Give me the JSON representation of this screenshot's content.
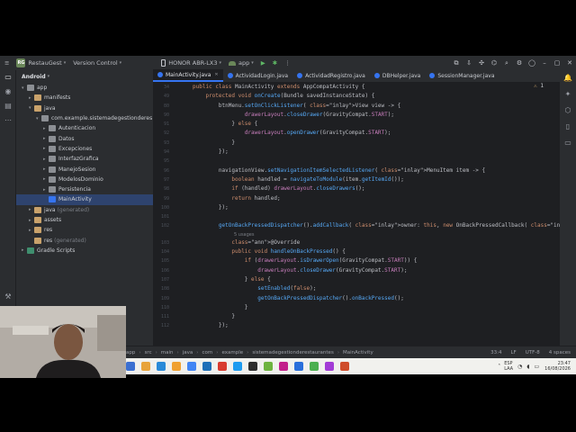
{
  "titlebar": {
    "project_badge": "RG",
    "project_name": "RestauGest",
    "vcs": "Version Control",
    "device": "HONOR ABR-LX3",
    "run_config": "app"
  },
  "project_panel": {
    "title": "Android",
    "tree": [
      {
        "label": "app",
        "indent": 0,
        "arrow": "▾",
        "icon": "fold-grey",
        "muted": ""
      },
      {
        "label": "manifests",
        "indent": 1,
        "arrow": "▸",
        "icon": "fold",
        "muted": ""
      },
      {
        "label": "java",
        "indent": 1,
        "arrow": "▾",
        "icon": "fold",
        "muted": ""
      },
      {
        "label": "com.example.sistemadegestionderes",
        "indent": 2,
        "arrow": "▾",
        "icon": "fold-grey",
        "muted": ""
      },
      {
        "label": "Autenticacion",
        "indent": 3,
        "arrow": "▸",
        "icon": "fold-grey",
        "muted": ""
      },
      {
        "label": "Datos",
        "indent": 3,
        "arrow": "▸",
        "icon": "fold-grey",
        "muted": ""
      },
      {
        "label": "Excepciones",
        "indent": 3,
        "arrow": "▸",
        "icon": "fold-grey",
        "muted": ""
      },
      {
        "label": "InterfazGrafica",
        "indent": 3,
        "arrow": "▸",
        "icon": "fold-grey",
        "muted": ""
      },
      {
        "label": "ManejoSesion",
        "indent": 3,
        "arrow": "▸",
        "icon": "fold-grey",
        "muted": ""
      },
      {
        "label": "ModelosDominio",
        "indent": 3,
        "arrow": "▸",
        "icon": "fold-grey",
        "muted": ""
      },
      {
        "label": "Persistencia",
        "indent": 3,
        "arrow": "▸",
        "icon": "fold-grey",
        "muted": ""
      },
      {
        "label": "MainActivity",
        "indent": 3,
        "arrow": "",
        "icon": "java-ico",
        "muted": "",
        "selected": true
      },
      {
        "label": "java",
        "indent": 1,
        "arrow": "▸",
        "icon": "fold",
        "muted": "(generated)"
      },
      {
        "label": "assets",
        "indent": 1,
        "arrow": "▸",
        "icon": "fold",
        "muted": ""
      },
      {
        "label": "res",
        "indent": 1,
        "arrow": "▸",
        "icon": "fold",
        "muted": ""
      },
      {
        "label": "res",
        "indent": 1,
        "arrow": "",
        "icon": "fold",
        "muted": "(generated)"
      },
      {
        "label": "Gradle Scripts",
        "indent": 0,
        "arrow": "▸",
        "icon": "gradle-ico",
        "muted": ""
      }
    ]
  },
  "tabs": [
    {
      "label": "MainActivity.java",
      "active": true
    },
    {
      "label": "ActividadLogin.java",
      "active": false
    },
    {
      "label": "ActividadRegistro.java",
      "active": false
    },
    {
      "label": "DBHelper.java",
      "active": false
    },
    {
      "label": "SessionManager.java",
      "active": false
    }
  ],
  "editor": {
    "warning_count": "1",
    "lines": [
      {
        "n": "34",
        "t": "public class MainActivity extends AppCompatActivity {"
      },
      {
        "n": "49",
        "t": "    protected void onCreate(Bundle savedInstanceState) {"
      },
      {
        "n": "80",
        "t": "        btnMenu.setOnClickListener( View view -> {"
      },
      {
        "n": "90",
        "t": "                drawerLayout.closeDrawer(GravityCompat.START);"
      },
      {
        "n": "91",
        "t": "            } else {"
      },
      {
        "n": "92",
        "t": "                drawerLayout.openDrawer(GravityCompat.START);"
      },
      {
        "n": "93",
        "t": "            }"
      },
      {
        "n": "94",
        "t": "        });"
      },
      {
        "n": "95",
        "t": ""
      },
      {
        "n": "96",
        "t": "        navigationView.setNavigationItemSelectedListener( MenuItem item -> {"
      },
      {
        "n": "97",
        "t": "            boolean handled = navigateToModule(item.getItemId());"
      },
      {
        "n": "98",
        "t": "            if (handled) drawerLayout.closeDrawers();"
      },
      {
        "n": "99",
        "t": "            return handled;"
      },
      {
        "n": "100",
        "t": "        });"
      },
      {
        "n": "101",
        "t": ""
      },
      {
        "n": "102",
        "t": "        getOnBackPressedDispatcher().addCallback( owner: this, new OnBackPressedCallback( enabled: true) {"
      },
      {
        "n": "",
        "t": "5 usages",
        "hint": true
      },
      {
        "n": "103",
        "t": "            @Override"
      },
      {
        "n": "104",
        "t": "            public void handleOnBackPressed() {"
      },
      {
        "n": "105",
        "t": "                if (drawerLayout.isDrawerOpen(GravityCompat.START)) {"
      },
      {
        "n": "106",
        "t": "                    drawerLayout.closeDrawer(GravityCompat.START);"
      },
      {
        "n": "107",
        "t": "                } else {"
      },
      {
        "n": "108",
        "t": "                    setEnabled(false);"
      },
      {
        "n": "109",
        "t": "                    getOnBackPressedDispatcher().onBackPressed();"
      },
      {
        "n": "110",
        "t": "                }"
      },
      {
        "n": "111",
        "t": "            }"
      },
      {
        "n": "112",
        "t": "        });"
      }
    ]
  },
  "statusbar": {
    "crumbs": [
      "app",
      "src",
      "main",
      "java",
      "com",
      "example",
      "sistemadegestionderestaurantes",
      "MainActivity"
    ],
    "position": "33:4",
    "line_sep": "LF",
    "encoding": "UTF-8",
    "indent": "4 spaces"
  },
  "tray": {
    "lang_top": "ESP",
    "lang_bottom": "LAA",
    "time": "23:47",
    "date": "16/08/2026"
  },
  "taskbar_icons": [
    "#3b6fd1",
    "#e8a33a",
    "#2a8ad8",
    "#f0a030",
    "#4285f4",
    "#1e6fb8",
    "#d83b2f",
    "#1d9bf0",
    "#2d2d2d",
    "#6db33f",
    "#c21f8a",
    "#2a6fdb",
    "#4caf50",
    "#a23cd6",
    "#cf4d2b"
  ],
  "colors": {
    "accent": "#3574f0",
    "selection": "#2e436e",
    "editor_bg": "#1e1f22",
    "panel_bg": "#2b2d30"
  }
}
